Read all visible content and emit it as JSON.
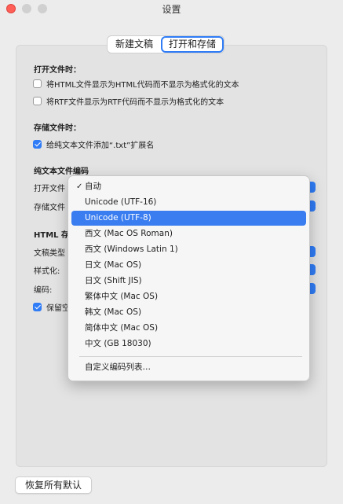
{
  "window": {
    "title": "设置"
  },
  "tabs": [
    {
      "label": "新建文稿",
      "active": false
    },
    {
      "label": "打开和存储",
      "active": true
    }
  ],
  "open_section": {
    "title": "打开文件时：",
    "options": [
      {
        "label": "将HTML文件显示为HTML代码而不显示为格式化的文本",
        "checked": false
      },
      {
        "label": "将RTF文件显示为RTF代码而不显示为格式化的文本",
        "checked": false
      }
    ]
  },
  "save_section": {
    "title": "存储文件时：",
    "options": [
      {
        "label": "给纯文本文件添加“.txt”扩展名",
        "checked": true
      }
    ]
  },
  "encoding_section": {
    "title": "纯文本文件编码",
    "open_label": "打开文件",
    "save_label": "存储文件"
  },
  "html_section": {
    "title": "HTML 存",
    "doc_type_label": "文稿类型",
    "style_label": "样式化:",
    "encoding_label": "编码:",
    "preserve_label": "保留空",
    "preserve_checked": true
  },
  "encoding_menu": {
    "items": [
      {
        "label": "自动",
        "checked": true,
        "highlighted": false
      },
      {
        "label": "Unicode (UTF-16)",
        "checked": false,
        "highlighted": false
      },
      {
        "label": "Unicode (UTF-8)",
        "checked": false,
        "highlighted": true
      },
      {
        "label": "西文 (Mac OS Roman)",
        "checked": false,
        "highlighted": false
      },
      {
        "label": "西文 (Windows Latin 1)",
        "checked": false,
        "highlighted": false
      },
      {
        "label": "日文 (Mac OS)",
        "checked": false,
        "highlighted": false
      },
      {
        "label": "日文 (Shift JIS)",
        "checked": false,
        "highlighted": false
      },
      {
        "label": "繁体中文 (Mac OS)",
        "checked": false,
        "highlighted": false
      },
      {
        "label": "韩文 (Mac OS)",
        "checked": false,
        "highlighted": false
      },
      {
        "label": "简体中文 (Mac OS)",
        "checked": false,
        "highlighted": false
      },
      {
        "label": "中文 (GB 18030)",
        "checked": false,
        "highlighted": false
      }
    ],
    "custom_item": "自定义编码列表…",
    "check_glyph": "✓"
  },
  "footer": {
    "restore_label": "恢复所有默认"
  },
  "colors": {
    "accent": "#2f7cf6",
    "close": "#ff5f57",
    "highlight": "#3a7df0"
  }
}
